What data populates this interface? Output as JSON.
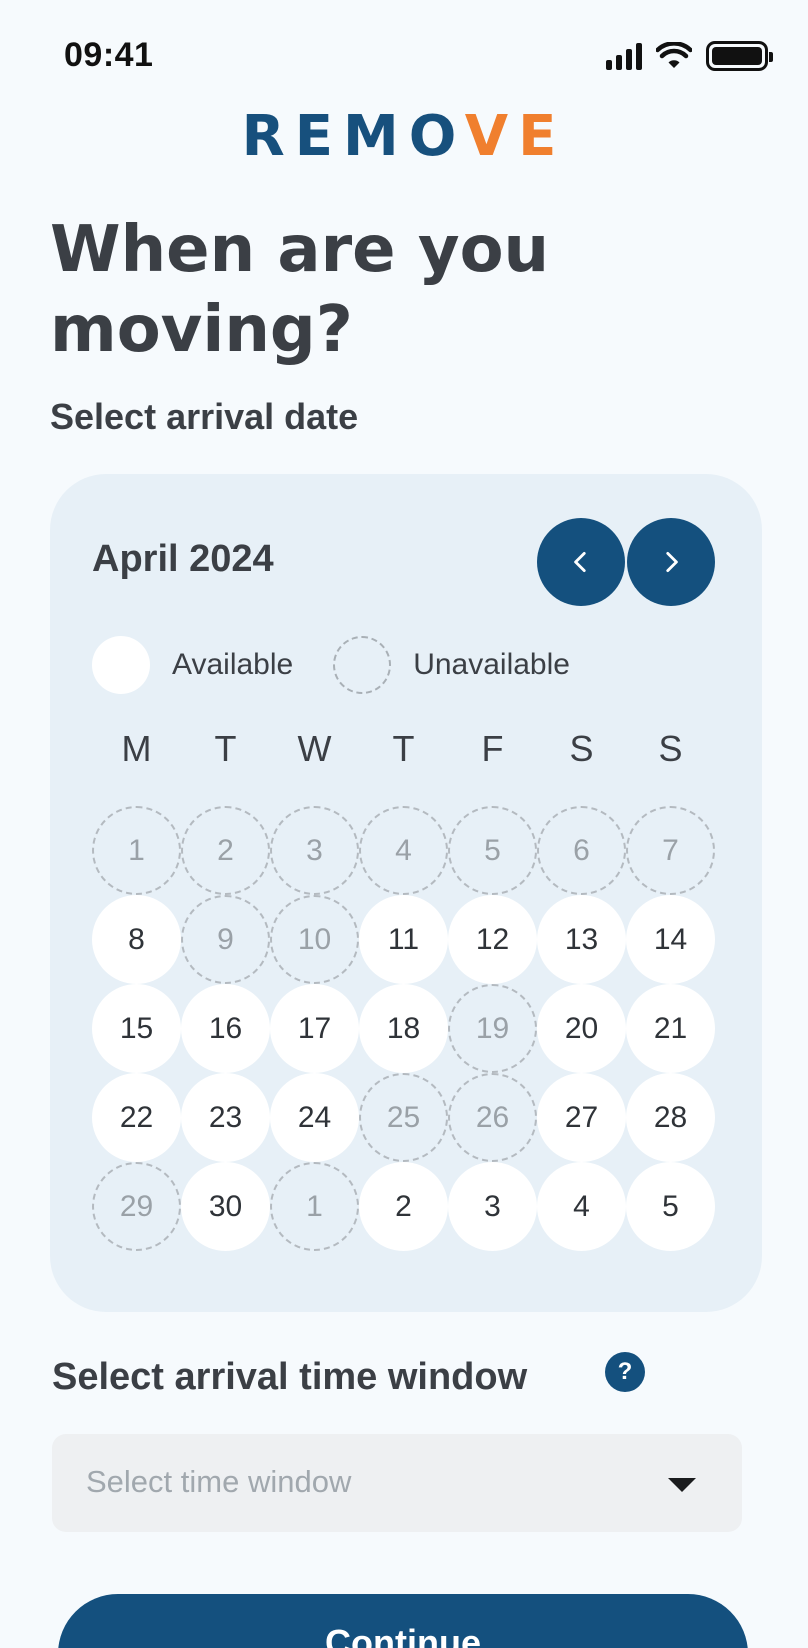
{
  "status_bar": {
    "time": "09:41"
  },
  "logo": {
    "part1": "REMO",
    "part2": "VE"
  },
  "heading": "When are you moving?",
  "subheading": "Select arrival date",
  "calendar": {
    "month": "April 2024",
    "legend": {
      "available": "Available",
      "unavailable": "Unavailable"
    },
    "weekdays": [
      "M",
      "T",
      "W",
      "T",
      "F",
      "S",
      "S"
    ],
    "days": [
      {
        "label": "1",
        "available": false
      },
      {
        "label": "2",
        "available": false
      },
      {
        "label": "3",
        "available": false
      },
      {
        "label": "4",
        "available": false
      },
      {
        "label": "5",
        "available": false
      },
      {
        "label": "6",
        "available": false
      },
      {
        "label": "7",
        "available": false
      },
      {
        "label": "8",
        "available": true
      },
      {
        "label": "9",
        "available": false
      },
      {
        "label": "10",
        "available": false
      },
      {
        "label": "11",
        "available": true
      },
      {
        "label": "12",
        "available": true
      },
      {
        "label": "13",
        "available": true
      },
      {
        "label": "14",
        "available": true
      },
      {
        "label": "15",
        "available": true
      },
      {
        "label": "16",
        "available": true
      },
      {
        "label": "17",
        "available": true
      },
      {
        "label": "18",
        "available": true
      },
      {
        "label": "19",
        "available": false
      },
      {
        "label": "20",
        "available": true
      },
      {
        "label": "21",
        "available": true
      },
      {
        "label": "22",
        "available": true
      },
      {
        "label": "23",
        "available": true
      },
      {
        "label": "24",
        "available": true
      },
      {
        "label": "25",
        "available": false
      },
      {
        "label": "26",
        "available": false
      },
      {
        "label": "27",
        "available": true
      },
      {
        "label": "28",
        "available": true
      },
      {
        "label": "29",
        "available": false
      },
      {
        "label": "30",
        "available": true
      },
      {
        "label": "1",
        "available": false
      },
      {
        "label": "2",
        "available": true
      },
      {
        "label": "3",
        "available": true
      },
      {
        "label": "4",
        "available": true
      },
      {
        "label": "5",
        "available": true
      }
    ]
  },
  "time_window": {
    "heading": "Select arrival time window",
    "help_symbol": "?",
    "placeholder": "Select time window"
  },
  "continue_label": "Continue",
  "colors": {
    "brand_blue": "#14507e",
    "brand_orange": "#f07f2e"
  }
}
